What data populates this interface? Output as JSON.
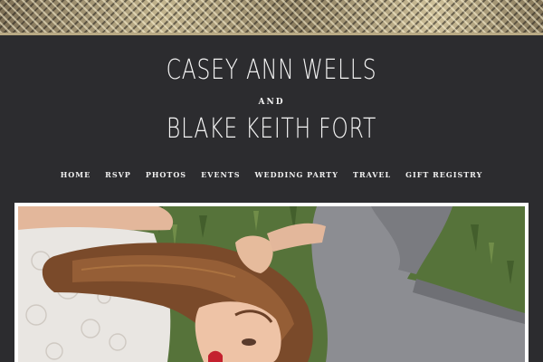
{
  "header": {
    "name_1": "CASEY ANN WELLS",
    "conjunction": "and",
    "name_2": "BLAKE KEITH FORT"
  },
  "nav": {
    "items": [
      "HOME",
      "RSVP",
      "PHOTOS",
      "EVENTS",
      "WEDDING PARTY",
      "TRAVEL",
      "GIFT REGISTRY"
    ]
  },
  "colors": {
    "background": "#2c2c2f",
    "accent_gold": "#b8a984",
    "text": "#f4f4f4"
  }
}
